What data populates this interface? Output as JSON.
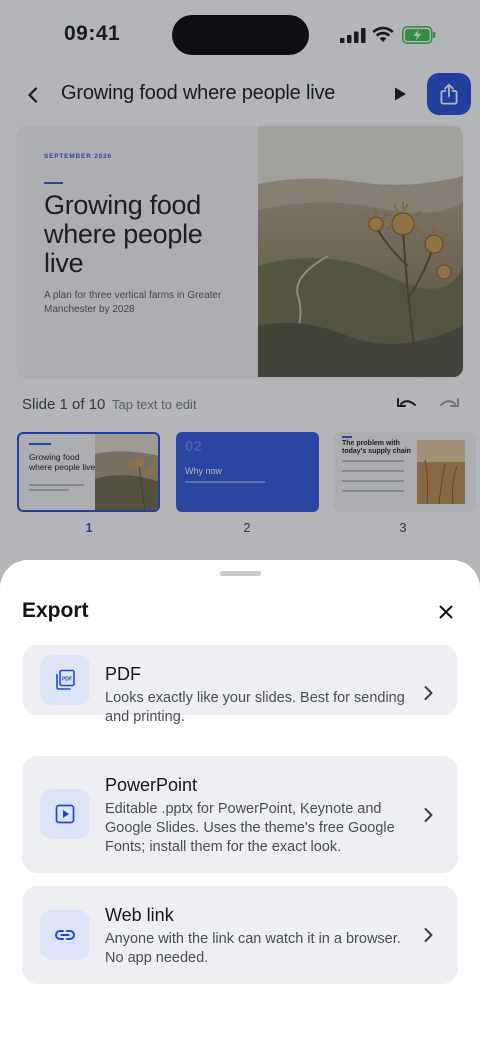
{
  "status_bar": {
    "time": "09:41"
  },
  "top_bar": {
    "title": "Growing food where people live"
  },
  "slide": {
    "date": "SEPTEMBER 2026",
    "title": "Growing food where people live",
    "subtitle": "A plan for three vertical farms in Greater Manchester by 2028",
    "counter": "Slide 1 of 10",
    "hint": "Tap text to edit"
  },
  "thumbnails": [
    {
      "number": "1",
      "title": "Growing food where people live"
    },
    {
      "number": "2",
      "big": "02",
      "title": "Why now"
    },
    {
      "number": "3",
      "title": "The problem with today's supply chain"
    }
  ],
  "export_sheet": {
    "title": "Export",
    "options": [
      {
        "title": "PDF",
        "icon": "pdf-icon",
        "badge": "PDF",
        "description": "Looks exactly like your slides. Best for sending and printing."
      },
      {
        "title": "PowerPoint",
        "icon": "play-square-icon",
        "description": "Editable .pptx for PowerPoint, Keynote and Google Slides. Uses the theme's free Google Fonts; install them for the exact look."
      },
      {
        "title": "Web link",
        "icon": "link-icon",
        "description": "Anyone with the link can watch it in a browser. No app needed."
      }
    ]
  },
  "colors": {
    "accent": "#1f49d6",
    "sheet_card": "#edeff3",
    "icon_tile": "#dde4f7"
  }
}
